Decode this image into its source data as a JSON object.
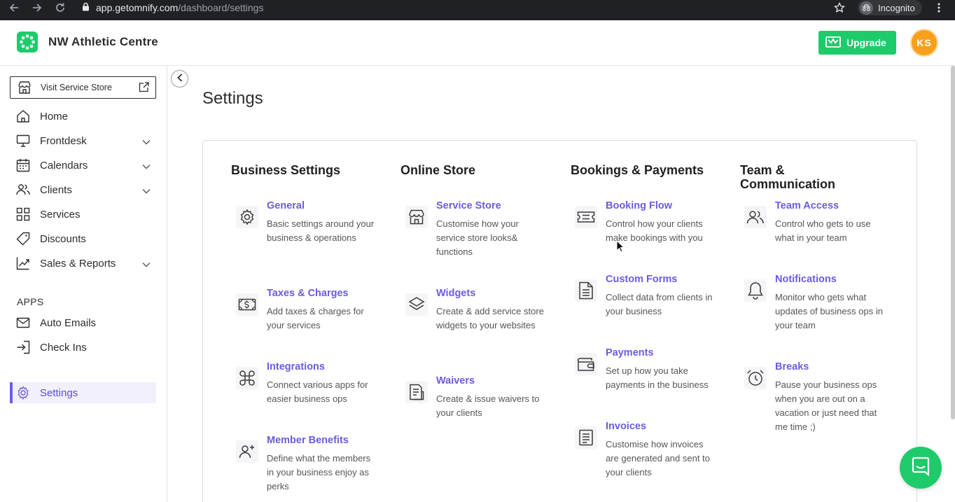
{
  "browser": {
    "url_host": "app.getomnify.com",
    "url_path": "/dashboard/settings",
    "incognito_label": "Incognito"
  },
  "header": {
    "brand": "NW Athletic Centre",
    "upgrade_label": "Upgrade",
    "avatar_initials": "KS",
    "accent_color": "#1ecb6b",
    "avatar_color": "#f9a01b"
  },
  "sidebar": {
    "visit_label": "Visit Service Store",
    "items": [
      {
        "label": "Home",
        "icon": "home-icon"
      },
      {
        "label": "Frontdesk",
        "icon": "monitor-icon",
        "expandable": true
      },
      {
        "label": "Calendars",
        "icon": "calendar-icon",
        "expandable": true
      },
      {
        "label": "Clients",
        "icon": "users-icon",
        "expandable": true
      },
      {
        "label": "Services",
        "icon": "grid-icon"
      },
      {
        "label": "Discounts",
        "icon": "tag-icon"
      },
      {
        "label": "Sales & Reports",
        "icon": "chart-icon",
        "expandable": true
      }
    ],
    "apps_title": "APPS",
    "apps": [
      {
        "label": "Auto Emails",
        "icon": "mail-icon"
      },
      {
        "label": "Check Ins",
        "icon": "sign-in-icon"
      }
    ],
    "settings_label": "Settings"
  },
  "main": {
    "title": "Settings",
    "columns": [
      {
        "title": "Business Settings",
        "items": [
          {
            "title": "General",
            "desc": "Basic settings around your business & operations",
            "icon": "gear-icon"
          },
          {
            "title": "Taxes & Charges",
            "desc": "Add taxes & charges for your services",
            "icon": "dollar-bill-icon"
          },
          {
            "title": "Integrations",
            "desc": "Connect various apps for easier business ops",
            "icon": "command-icon"
          },
          {
            "title": "Member Benefits",
            "desc": "Define what the members in your business enjoy as perks",
            "icon": "user-plus-icon"
          }
        ]
      },
      {
        "title": "Online Store",
        "items": [
          {
            "title": "Service Store",
            "desc": "Customise how your service store looks& functions",
            "icon": "store-icon"
          },
          {
            "title": "Widgets",
            "desc": "Create & add service store widgets to your websites",
            "icon": "layers-icon"
          },
          {
            "title": "Waivers",
            "desc": "Create & issue waivers to your clients",
            "icon": "document-icon"
          }
        ]
      },
      {
        "title": "Bookings & Payments",
        "items": [
          {
            "title": "Booking Flow",
            "desc": "Control how your clients make bookings with you",
            "icon": "ticket-icon"
          },
          {
            "title": "Custom Forms",
            "desc": "Collect data from clients in your business",
            "icon": "form-icon"
          },
          {
            "title": "Payments",
            "desc": "Set up how you take payments in the business",
            "icon": "wallet-icon"
          },
          {
            "title": "Invoices",
            "desc": "Customise how invoices are generated and sent to your clients",
            "icon": "invoice-icon"
          }
        ]
      },
      {
        "title": "Team & Communication",
        "items": [
          {
            "title": "Team Access",
            "desc": "Control who gets to use what in your team",
            "icon": "team-icon"
          },
          {
            "title": "Notifications",
            "desc": "Monitor who gets what updates of business ops in your team",
            "icon": "bell-icon"
          },
          {
            "title": "Breaks",
            "desc": "Pause your business ops when you are out on a vacation or just need that me time ;)",
            "icon": "alarm-clock-icon"
          }
        ]
      }
    ],
    "link_color": "#6a5ce0"
  }
}
